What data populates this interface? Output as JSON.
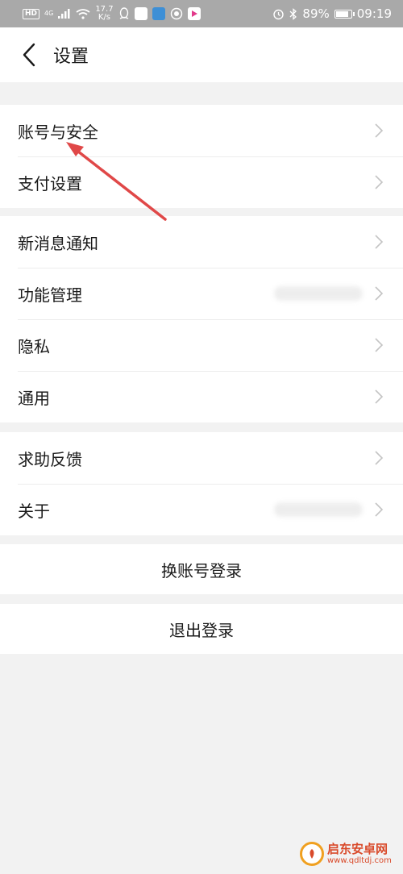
{
  "status_bar": {
    "hd": "HD",
    "network": "4G",
    "speed_value": "17.7",
    "speed_unit": "K/s",
    "battery": "89%",
    "time": "09:19",
    "battery_level": 0.89
  },
  "header": {
    "title": "设置"
  },
  "groups": [
    {
      "items": [
        {
          "label": "账号与安全"
        },
        {
          "label": "支付设置"
        }
      ]
    },
    {
      "items": [
        {
          "label": "新消息通知"
        },
        {
          "label": "功能管理"
        },
        {
          "label": "隐私"
        },
        {
          "label": "通用"
        }
      ]
    },
    {
      "items": [
        {
          "label": "求助反馈"
        },
        {
          "label": "关于"
        }
      ]
    }
  ],
  "actions": {
    "switch_account": "换账号登录",
    "logout": "退出登录"
  },
  "watermark": {
    "name": "启东安卓网",
    "url": "www.qdltdj.com"
  },
  "colors": {
    "status_bar_bg": "#a9a9a9",
    "page_bg": "#f2f2f2",
    "annotation_arrow": "#e04848",
    "chevron": "#c4c4c4"
  }
}
